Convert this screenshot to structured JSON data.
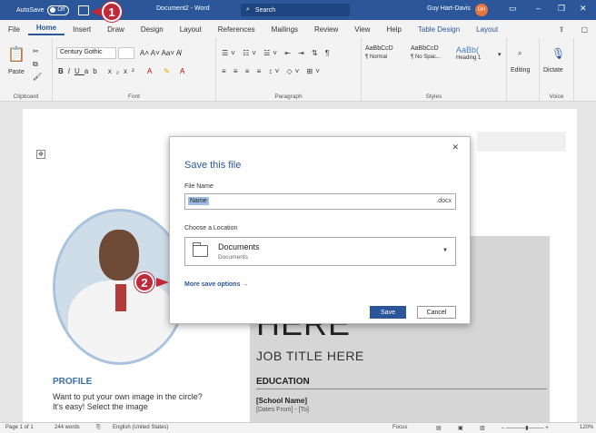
{
  "titlebar": {
    "autosave_label": "AutoSave",
    "autosave_state": "Off",
    "doc_name": "Document2 - Word",
    "search_placeholder": "Search",
    "user_name": "Guy Hart-Davis",
    "user_initials": "GH"
  },
  "menu": {
    "tabs": [
      "File",
      "Home",
      "Insert",
      "Draw",
      "Design",
      "Layout",
      "References",
      "Mailings",
      "Review",
      "View",
      "Help",
      "Table Design",
      "Layout"
    ],
    "active": "Home"
  },
  "ribbon": {
    "clipboard": {
      "paste_label": "Paste",
      "group_label": "Clipboard"
    },
    "font": {
      "font_name": "Century Gothic",
      "group_label": "Font"
    },
    "paragraph": {
      "group_label": "Paragraph"
    },
    "styles": {
      "items": [
        {
          "preview": "AaBbCcD",
          "name": "¶ Normal"
        },
        {
          "preview": "AaBbCcD",
          "name": "¶ No Spac..."
        },
        {
          "preview": "AaBb(",
          "name": "Heading 1"
        }
      ],
      "group_label": "Styles"
    },
    "editing_label": "Editing",
    "voice": {
      "dictate_label": "Dictate",
      "group_label": "Voice"
    }
  },
  "document": {
    "title_partial": "HERE",
    "job_title": "JOB TITLE HERE",
    "education_heading": "EDUCATION",
    "school_name": "[School Name]",
    "dates": "[Dates From] - [To]",
    "profile_heading": "PROFILE",
    "profile_text": "Want to put your own image in the circle? It's easy! Select the image"
  },
  "dialog": {
    "title": "Save this file",
    "file_name_label": "File Name",
    "file_name_value": "Name",
    "file_ext": ".docx",
    "location_label": "Choose a Location",
    "location_main": "Documents",
    "location_sub": "Documents",
    "more_options": "More save options →",
    "save_label": "Save",
    "cancel_label": "Cancel"
  },
  "callouts": {
    "one": "1",
    "two": "2"
  },
  "statusbar": {
    "page": "Page 1 of 1",
    "words": "244 words",
    "language": "English (United States)",
    "focus": "Focus",
    "zoom": "120%"
  },
  "colors": {
    "accent": "#2b579a",
    "callout": "#c0293a"
  }
}
